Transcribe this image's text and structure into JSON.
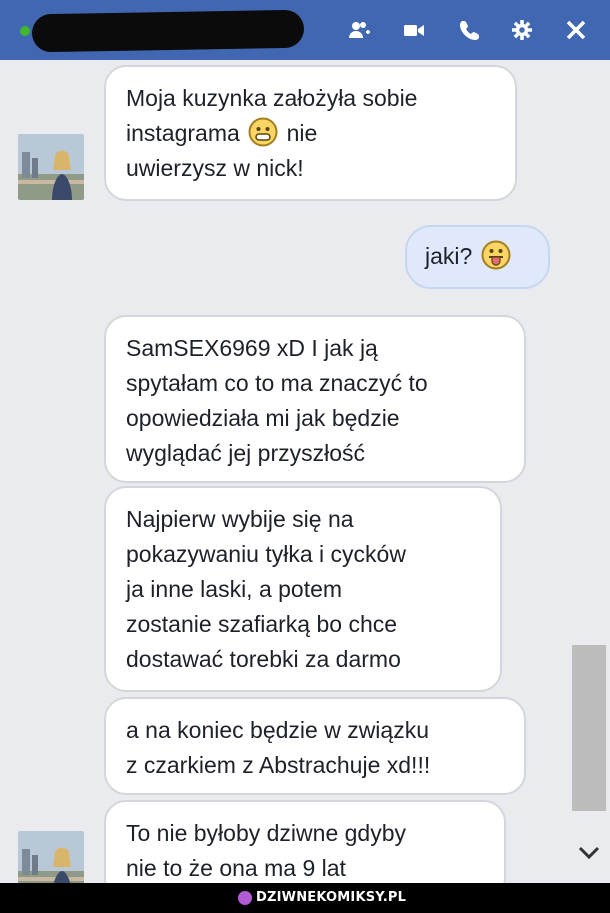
{
  "header": {
    "online_color": "#42b72a",
    "icons": [
      "add-people-icon",
      "video-call-icon",
      "phone-icon",
      "gear-icon",
      "close-icon"
    ]
  },
  "messages": [
    {
      "side": "in",
      "lines": [
        "Moja kuzynka założyła sobie",
        "instagrama",
        "nie",
        "uwierzysz w nick!"
      ],
      "emoji": "smile-emoji"
    },
    {
      "side": "out",
      "text": "jaki?",
      "emoji": "tongue-emoji"
    },
    {
      "side": "in",
      "lines": [
        "SamSEX6969 xD I jak ją",
        "spytałam co to ma znaczyć to",
        "opowiedziała mi jak będzie",
        "wyglądać jej przyszłość"
      ]
    },
    {
      "side": "in",
      "lines": [
        "Najpierw wybije się na",
        "pokazywaniu tyłka i cycków",
        "ja inne laski, a potem",
        "zostanie szafiarką bo chce",
        "dostawać torebki za darmo"
      ]
    },
    {
      "side": "in",
      "lines": [
        "a na koniec będzie w związku",
        "z czarkiem z Abstrachuje xd!!!"
      ]
    },
    {
      "side": "in",
      "lines": [
        "To nie byłoby dziwne gdyby",
        "nie to że ona ma 9 lat"
      ]
    }
  ],
  "footer": {
    "brand": "DZIWNEKOMIKSY.PL"
  },
  "colors": {
    "header": "#4267b2",
    "incoming": "#ffffff",
    "outgoing": "#dfe9fb",
    "background": "#e9ebee"
  }
}
